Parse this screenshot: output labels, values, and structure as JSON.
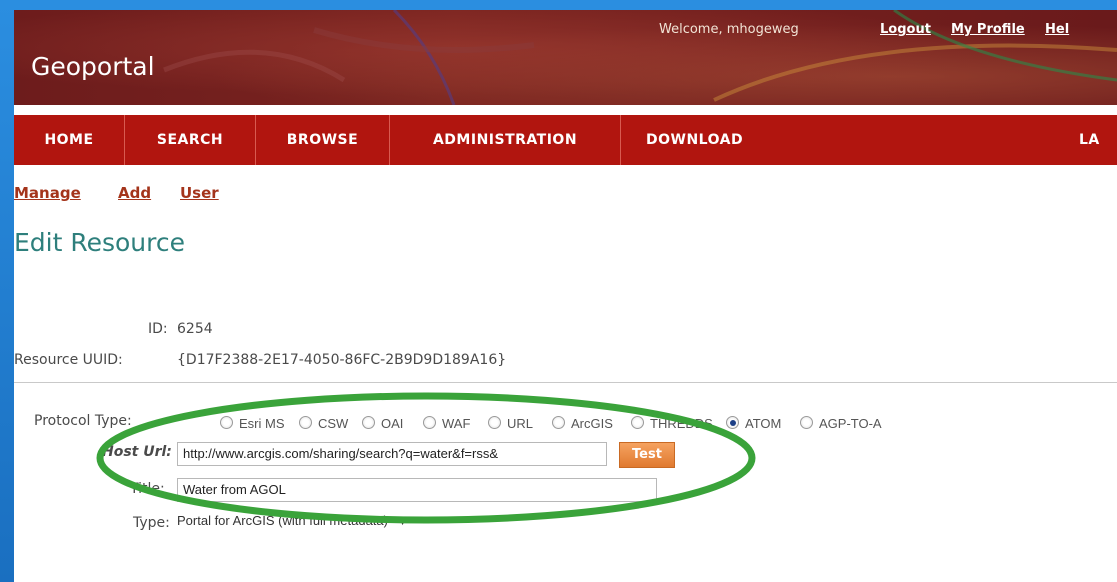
{
  "app": {
    "title": "Geoportal"
  },
  "header": {
    "welcome_text": "Welcome, mhogeweg",
    "logout_label": "Logout",
    "profile_label": "My Profile",
    "help_label": "Hel"
  },
  "nav": {
    "items": [
      "HOME",
      "SEARCH",
      "BROWSE",
      "ADMINISTRATION",
      "DOWNLOAD",
      "LA"
    ]
  },
  "subnav": {
    "manage": "Manage",
    "add": "Add",
    "user": "User"
  },
  "page": {
    "title": "Edit Resource"
  },
  "resource": {
    "id_label": "ID:",
    "id_value": "6254",
    "uuid_label": "Resource UUID:",
    "uuid_value": "{D17F2388-2E17-4050-86FC-2B9D9D189A16}"
  },
  "form": {
    "protocol_label": "Protocol Type:",
    "protocol_options": [
      "Esri MS",
      "CSW",
      "OAI",
      "WAF",
      "URL",
      "ArcGIS",
      "THREDDS",
      "ATOM",
      "AGP-TO-A"
    ],
    "protocol_selected": "ATOM",
    "host_url_label": "Host Url:",
    "host_url_value": "http://www.arcgis.com/sharing/search?q=water&f=rss&",
    "test_label": "Test",
    "title_label": "Title:",
    "title_value": "Water from AGOL",
    "type_label": "Type:",
    "type_value": "Portal for ArcGIS (with full metadata)"
  },
  "colors": {
    "nav_bg": "#b1150f",
    "banner_bg": "#6d1c1c",
    "link": "#a4341b",
    "heading": "#2e7f7c",
    "highlight_oval": "#3aa33a",
    "test_button": "#e88a3c"
  }
}
